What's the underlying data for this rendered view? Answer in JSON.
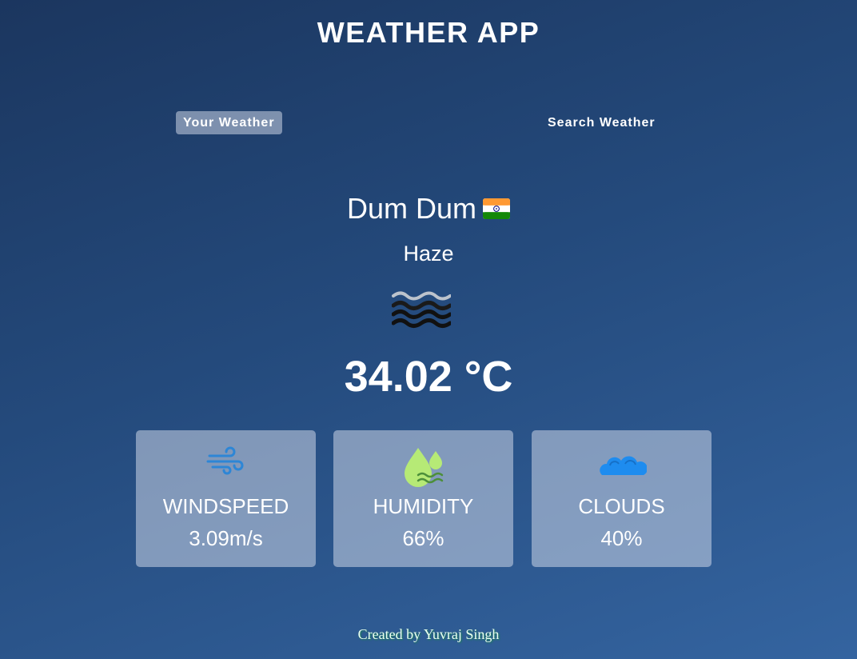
{
  "app": {
    "title": "WEATHER APP"
  },
  "tabs": [
    {
      "label": "Your Weather",
      "active": true
    },
    {
      "label": "Search Weather",
      "active": false
    }
  ],
  "weather": {
    "city": "Dum Dum",
    "country_flag_icon": "india-flag-icon",
    "condition": "Haze",
    "condition_icon": "haze-icon",
    "temperature": "34.02 °C"
  },
  "stats": [
    {
      "icon": "wind-icon",
      "label": "WINDSPEED",
      "value": "3.09m/s"
    },
    {
      "icon": "humidity-icon",
      "label": "HUMIDITY",
      "value": "66%"
    },
    {
      "icon": "clouds-icon",
      "label": "CLOUDS",
      "value": "40%"
    }
  ],
  "footer": {
    "text": "Created by Yuvraj Singh"
  },
  "colors": {
    "background_top": "#1b365f",
    "background_bottom": "#3464a0",
    "card_background": "rgba(219,226,239,0.5)",
    "footer_glow": "#1b8a4b"
  }
}
